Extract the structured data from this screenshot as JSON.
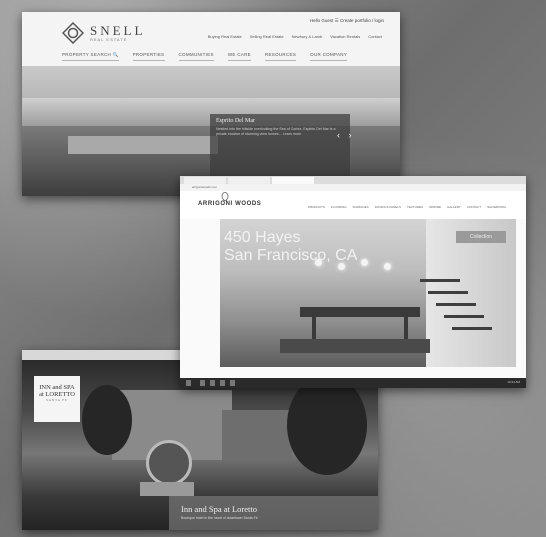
{
  "snell": {
    "brand": "SNELL",
    "sub": "REAL ESTATE",
    "util": "Hello Guest ☰ Create portfolio / login",
    "quick": [
      "Buying Real Estate",
      "Selling Real Estate",
      "Newbury & Lamb",
      "Vacation Rentals",
      "Contact"
    ],
    "nav": [
      "PROPERTY SEARCH 🔍",
      "PROPERTIES",
      "COMMUNITIES",
      "WE CARE",
      "RESOURCES",
      "OUR COMPANY"
    ],
    "caption_title": "Esprito Del Mar",
    "caption_text": "Nestled into the hillside overlooking the Sea of Cortez, Espiritu Del Mar is a private enclave of stunning view homes... Learn more",
    "arrows": "‹ ›"
  },
  "arrigoni": {
    "url": "arrigoniwoods.com",
    "logo": "ARRIGONI WOODS",
    "nav": [
      "PRODUCTS",
      "FLOORING",
      "SURFACES",
      "DOORS & PANELS",
      "TEXTURES",
      "INSPIRE",
      "GALLERY",
      "CONTACT",
      "SHOWROOM"
    ],
    "headline_1": "450 Hayes",
    "headline_2": "San Francisco, CA",
    "cta": "Collection",
    "clock": "10:24 AM"
  },
  "inn": {
    "logo_1": "INN and SPA",
    "logo_2": "at LORETTO",
    "logo_3": "SANTA FE",
    "title": "Inn and Spa at Loretto",
    "subtitle": "Boutique hotel in the heart of downtown Santa Fe"
  }
}
